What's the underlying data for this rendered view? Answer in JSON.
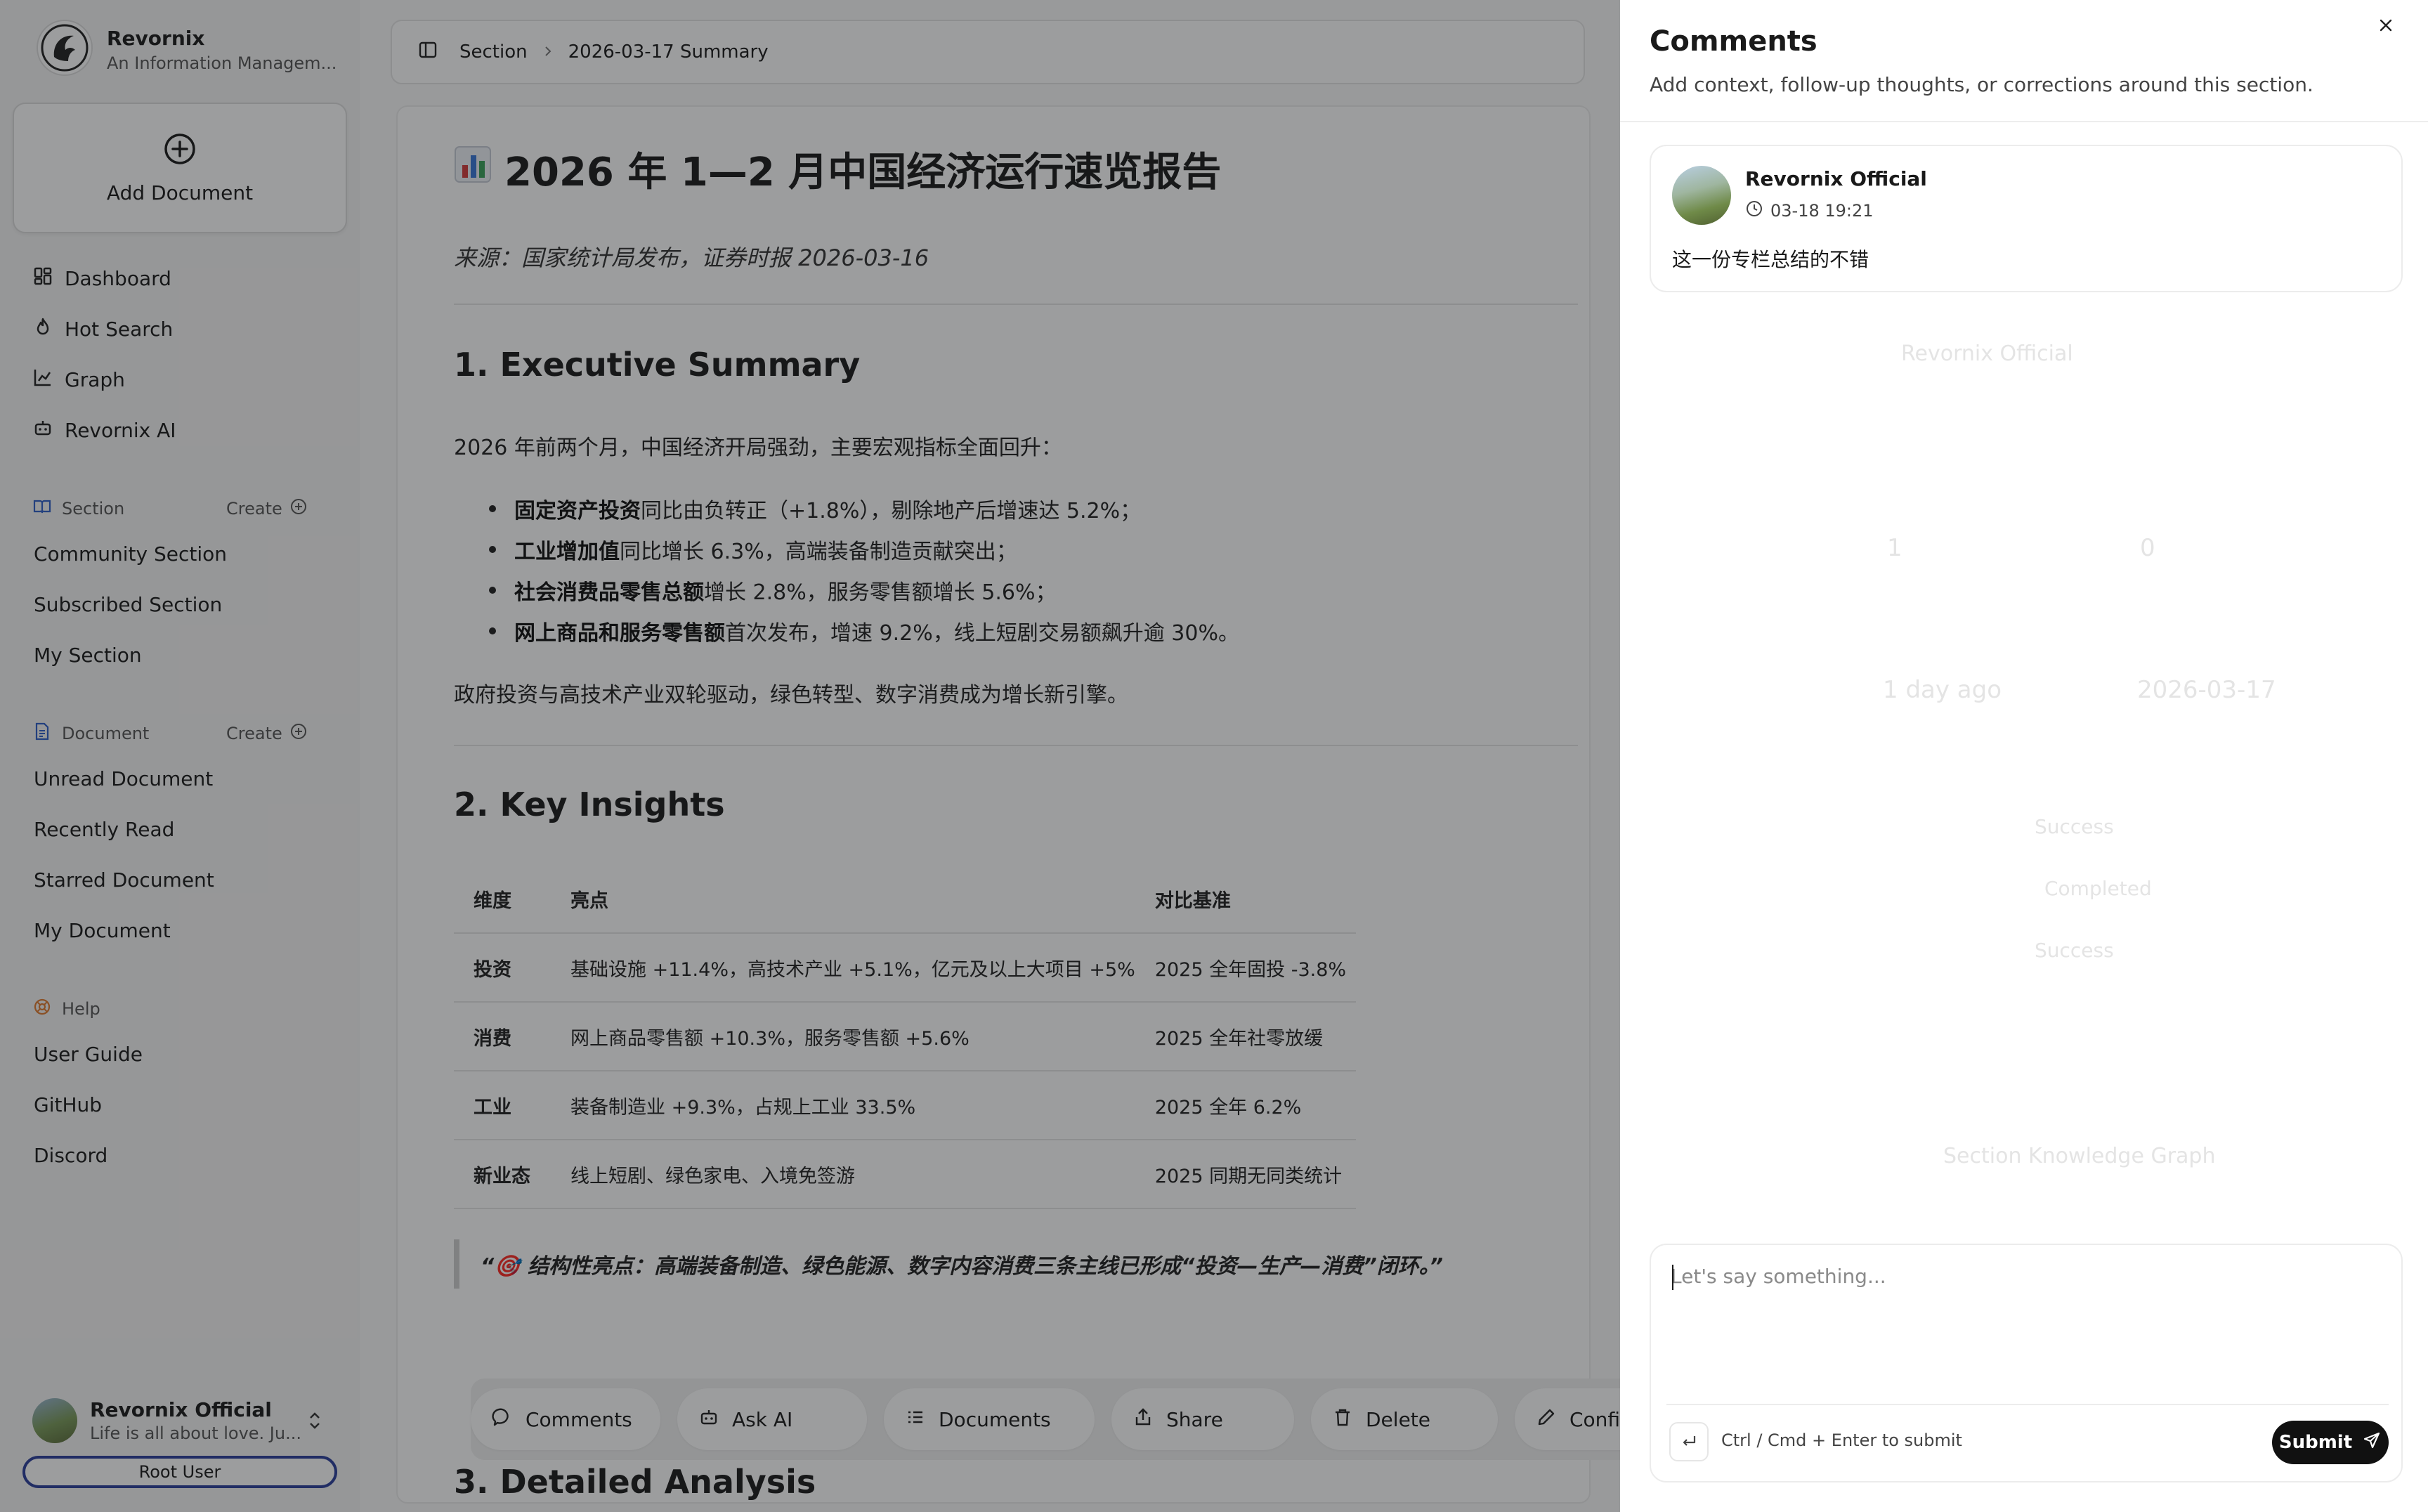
{
  "brand": {
    "name": "Revornix",
    "subtitle": "An Information Managem..."
  },
  "sidebar": {
    "add_document": "Add Document",
    "nav": [
      {
        "label": "Dashboard",
        "icon": "dashboard-icon"
      },
      {
        "label": "Hot Search",
        "icon": "flame-icon"
      },
      {
        "label": "Graph",
        "icon": "graph-icon"
      },
      {
        "label": "Revornix AI",
        "icon": "robot-icon"
      }
    ],
    "section_group": {
      "title": "Section",
      "create": "Create",
      "items": [
        "Community Section",
        "Subscribed Section",
        "My Section"
      ]
    },
    "document_group": {
      "title": "Document",
      "create": "Create",
      "items": [
        "Unread Document",
        "Recently Read",
        "Starred Document",
        "My Document"
      ]
    },
    "help_group": {
      "title": "Help",
      "items": [
        "User Guide",
        "GitHub",
        "Discord"
      ]
    },
    "user": {
      "name": "Revornix Official",
      "bio": "Life is all about love. Ju...",
      "role": "Root User"
    }
  },
  "breadcrumb": {
    "parent": "Section",
    "current": "2026-03-17 Summary"
  },
  "doc": {
    "title": "2026 年 1—2 月中国经济运行速览报告",
    "source": "来源：国家统计局发布，证券时报 2026-03-16",
    "h_exec": "1. Executive Summary",
    "exec_intro": "2026 年前两个月，中国经济开局强劲，主要宏观指标全面回升：",
    "bullets": [
      {
        "bold": "固定资产投资",
        "rest": "同比由负转正（+1.8%），剔除地产后增速达 5.2%；"
      },
      {
        "bold": "工业增加值",
        "rest": "同比增长 6.3%，高端装备制造贡献突出；"
      },
      {
        "bold": "社会消费品零售总额",
        "rest": "增长 2.8%，服务零售额增长 5.6%；"
      },
      {
        "bold": "网上商品和服务零售额",
        "rest": "首次发布，增速 9.2%，线上短剧交易额飙升逾 30%。"
      }
    ],
    "exec_outro": "政府投资与高技术产业双轮驱动，绿色转型、数字消费成为增长新引擎。",
    "h_insights": "2. Key Insights",
    "table": {
      "headers": [
        "维度",
        "亮点",
        "对比基准"
      ],
      "rows": [
        [
          "投资",
          "基础设施 +11.4%，高技术产业 +5.1%，亿元及以上大项目 +5%",
          "2025 全年固投 -3.8%"
        ],
        [
          "消费",
          "网上商品零售额 +10.3%，服务零售额 +5.6%",
          "2025 全年社零放缓"
        ],
        [
          "工业",
          "装备制造业 +9.3%，占规上工业 33.5%",
          "2025 全年 6.2%"
        ],
        [
          "新业态",
          "线上短剧、绿色家电、入境免签游",
          "2025 同期无同类统计"
        ]
      ]
    },
    "quote": "“🎯 结构性亮点：高端装备制造、绿色能源、数字内容消费三条主线已形成“投资—生产—消费”闭环。”",
    "h_detail": "3. Detailed Analysis"
  },
  "toolbar": {
    "comments": "Comments",
    "ask_ai": "Ask AI",
    "documents": "Documents",
    "share": "Share",
    "delete": "Delete",
    "config": "Config"
  },
  "panel_bg": {
    "name": "Revornix Official",
    "rel_time": "1 day ago",
    "date": "2026-03-17",
    "count_a": "1",
    "count_b": "0",
    "status_1": "Success",
    "status_2": "Completed",
    "status_3": "Success",
    "graph_title": "Section Knowledge Graph"
  },
  "comments": {
    "title": "Comments",
    "subtitle": "Add context, follow-up thoughts, or corrections around this section.",
    "items": [
      {
        "author": "Revornix Official",
        "time": "03-18 19:21",
        "text": "这一份专栏总结的不错"
      }
    ],
    "placeholder": "Let's say something...",
    "hint": "Ctrl / Cmd + Enter to submit",
    "submit": "Submit"
  },
  "colors": {
    "accent": "#2c3e9b",
    "submit_bg": "#111111",
    "overlay": "rgba(20,22,24,0.42)"
  }
}
